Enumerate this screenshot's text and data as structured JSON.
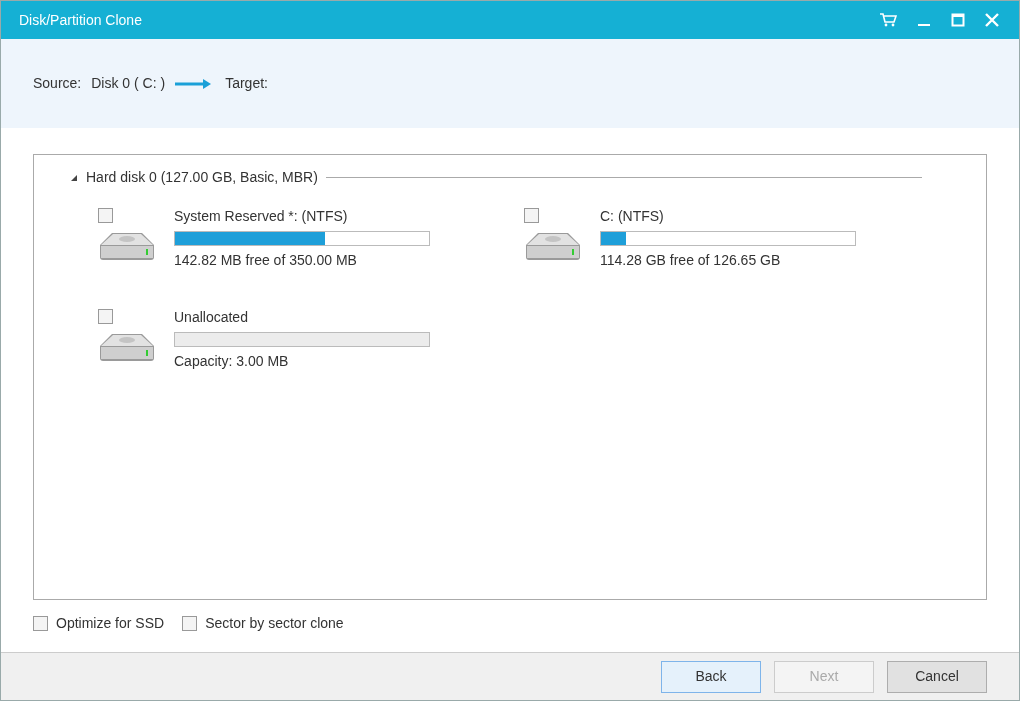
{
  "window": {
    "title": "Disk/Partition Clone"
  },
  "header": {
    "source_label": "Source:",
    "source_value": "Disk 0 ( C: )",
    "target_label": "Target:"
  },
  "disk": {
    "label": "Hard disk 0 (127.00 GB, Basic, MBR)",
    "expanded": true,
    "partitions": [
      {
        "name": "System Reserved *: (NTFS)",
        "checked": false,
        "level": 0.59,
        "detail": "142.82 MB free of 350.00 MB",
        "kind": "used"
      },
      {
        "name": "C: (NTFS)",
        "checked": false,
        "level": 0.1,
        "detail": "114.28 GB free of 126.65 GB",
        "kind": "used"
      },
      {
        "name": "Unallocated",
        "checked": false,
        "level": 0,
        "detail": "Capacity: 3.00 MB",
        "kind": "unallocated"
      }
    ]
  },
  "options": [
    {
      "label": "Optimize for SSD",
      "checked": false
    },
    {
      "label": "Sector by sector clone",
      "checked": false
    }
  ],
  "buttons": [
    {
      "label": "Back",
      "disabled": false
    },
    {
      "label": "Next",
      "disabled": true
    },
    {
      "label": "Cancel",
      "disabled": false
    }
  ]
}
